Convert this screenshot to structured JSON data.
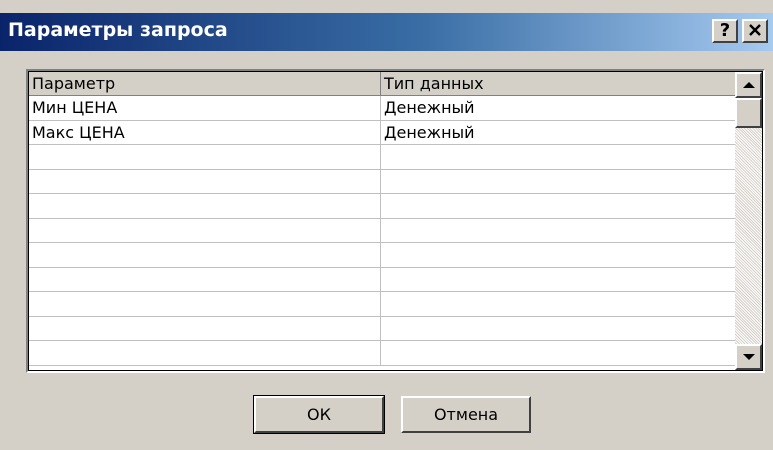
{
  "window": {
    "title": "Параметры запроса",
    "help_label": "?",
    "close_label": "✕"
  },
  "grid": {
    "columns": [
      "Параметр",
      "Тип данных"
    ],
    "rows": [
      [
        "Мин ЦЕНА",
        "Денежный"
      ],
      [
        "Макс ЦЕНА",
        "Денежный"
      ],
      [
        "",
        ""
      ],
      [
        "",
        ""
      ],
      [
        "",
        ""
      ],
      [
        "",
        ""
      ],
      [
        "",
        ""
      ],
      [
        "",
        ""
      ],
      [
        "",
        ""
      ],
      [
        "",
        ""
      ],
      [
        "",
        ""
      ]
    ]
  },
  "buttons": {
    "ok_label": "ОК",
    "cancel_label": "Отмена"
  },
  "colors": {
    "titlebar_start": "#0a246a",
    "titlebar_end": "#a6caf0",
    "dialog_bg": "#d4d0c8"
  }
}
